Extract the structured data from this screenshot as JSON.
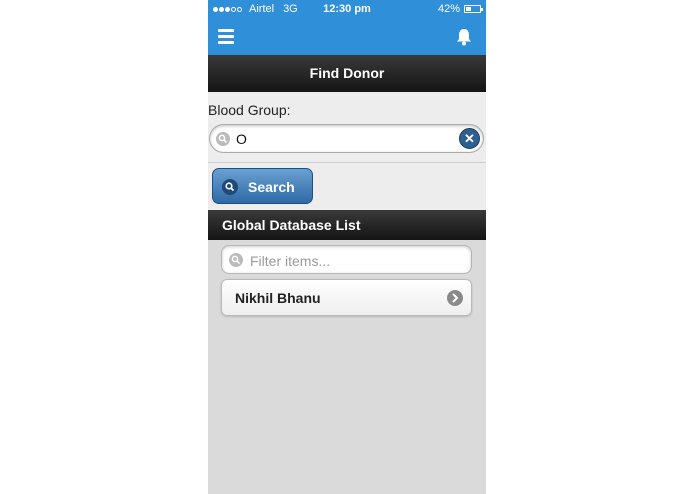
{
  "status_bar": {
    "carrier": "Airtel",
    "network": "3G",
    "time": "12:30 pm",
    "battery_text": "42%",
    "battery_level": 0.42,
    "signal_bars_filled": 3,
    "signal_bars_total": 5
  },
  "app_bar": {
    "menu_icon": "hamburger-menu-icon",
    "notification_icon": "bell-icon"
  },
  "page": {
    "title": "Find Donor"
  },
  "form": {
    "blood_group_label": "Blood Group:",
    "blood_group_value": "O",
    "search_button_label": "Search"
  },
  "list": {
    "header": "Global Database List",
    "filter_placeholder": "Filter items...",
    "items": [
      {
        "name": "Nikhil Bhanu"
      }
    ]
  },
  "colors": {
    "header_blue": "#2f8fd8",
    "button_blue": "#2e6aa8",
    "bar_dark": "#1a1a1a",
    "background": "#dadada"
  }
}
